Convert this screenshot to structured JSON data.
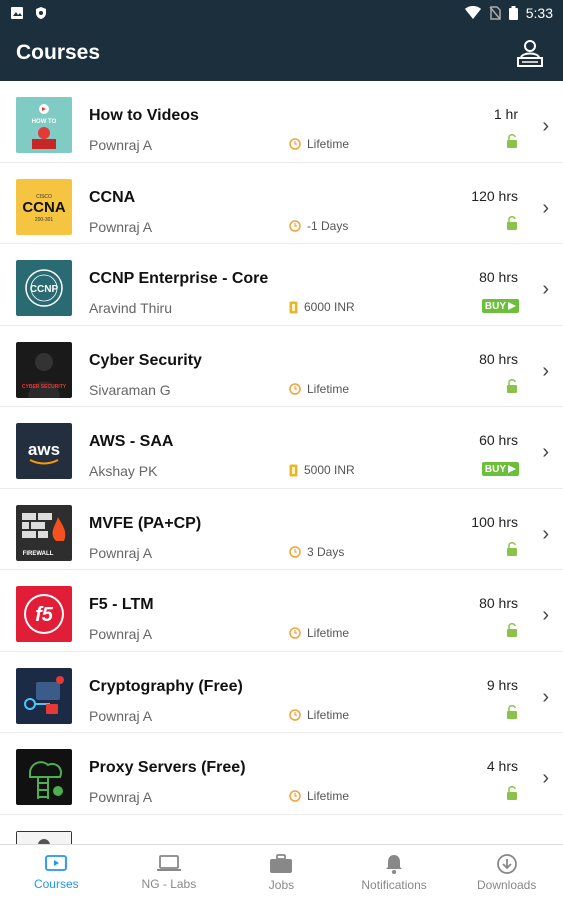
{
  "status_bar": {
    "time": "5:33"
  },
  "app_bar": {
    "title": "Courses"
  },
  "courses": [
    {
      "title": "How to Videos",
      "author": "Pownraj A",
      "validity": "Lifetime",
      "validity_type": "clock",
      "hours": "1 hr",
      "status": "unlocked"
    },
    {
      "title": "CCNA",
      "author": "Pownraj A",
      "validity": "-1 Days",
      "validity_type": "clock",
      "hours": "120 hrs",
      "status": "unlocked"
    },
    {
      "title": "CCNP Enterprise - Core",
      "author": "Aravind Thiru",
      "validity": "6000 INR",
      "validity_type": "price",
      "hours": "80 hrs",
      "status": "buy"
    },
    {
      "title": "Cyber Security",
      "author": "Sivaraman G",
      "validity": "Lifetime",
      "validity_type": "clock",
      "hours": "80 hrs",
      "status": "unlocked"
    },
    {
      "title": "AWS - SAA",
      "author": "Akshay PK",
      "validity": "5000 INR",
      "validity_type": "price",
      "hours": "60 hrs",
      "status": "buy"
    },
    {
      "title": "MVFE (PA+CP)",
      "author": "Pownraj A",
      "validity": "3 Days",
      "validity_type": "clock",
      "hours": "100 hrs",
      "status": "unlocked"
    },
    {
      "title": "F5 - LTM",
      "author": "Pownraj A",
      "validity": "Lifetime",
      "validity_type": "clock",
      "hours": "80 hrs",
      "status": "unlocked"
    },
    {
      "title": "Cryptography (Free)",
      "author": "Pownraj A",
      "validity": "Lifetime",
      "validity_type": "clock",
      "hours": "9 hrs",
      "status": "unlocked"
    },
    {
      "title": "Proxy Servers (Free)",
      "author": "Pownraj A",
      "validity": "Lifetime",
      "validity_type": "clock",
      "hours": "4 hrs",
      "status": "unlocked"
    }
  ],
  "buy_label": "BUY",
  "thumb_text": {
    "howto": "HOW TO",
    "ccna_cisco": "CISCO",
    "ccna": "CCNA",
    "ccna_code": "200-301",
    "ccnp": "CCNP",
    "cyber": "CYBER SECURITY",
    "aws": "aws",
    "firewall": "FIREWALL",
    "f5": "f5"
  },
  "bottom_nav": [
    {
      "label": "Courses",
      "icon": "play-tab-icon",
      "active": true
    },
    {
      "label": "NG - Labs",
      "icon": "laptop-icon",
      "active": false
    },
    {
      "label": "Jobs",
      "icon": "briefcase-icon",
      "active": false
    },
    {
      "label": "Notifications",
      "icon": "bell-icon",
      "active": false
    },
    {
      "label": "Downloads",
      "icon": "download-icon",
      "active": false
    }
  ],
  "colors": {
    "app_bar": "#1b2f3c",
    "active_tab": "#2196f3",
    "buy_badge": "#6cbf3a",
    "unlock": "#8bc34a",
    "clock": "#f2a33a"
  }
}
